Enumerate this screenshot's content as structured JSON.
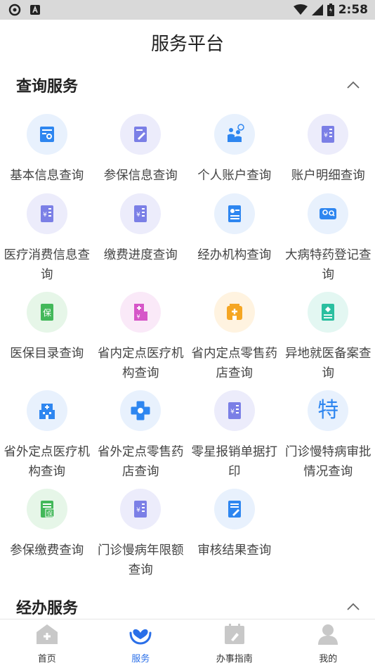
{
  "status": {
    "time": "2:58"
  },
  "header": {
    "title": "服务平台"
  },
  "query_section": {
    "title": "查询服务",
    "items": [
      {
        "label": "基本信息查询",
        "icon": "certificate-icon",
        "color": "#2e86f0",
        "bg": "#e8f1fd"
      },
      {
        "label": "参保信息查询",
        "icon": "edit-document-icon",
        "color": "#7b7fe6",
        "bg": "#ececfb"
      },
      {
        "label": "个人账户查询",
        "icon": "people-icon",
        "color": "#2e86f0",
        "bg": "#e8f1fd"
      },
      {
        "label": "账户明细查询",
        "icon": "ledger-icon",
        "color": "#7b7fe6",
        "bg": "#ececfb"
      },
      {
        "label": "医疗消费信息查询",
        "icon": "ledger-icon",
        "color": "#7b7fe6",
        "bg": "#ececfb"
      },
      {
        "label": "缴费进度查询",
        "icon": "ledger-icon",
        "color": "#7b7fe6",
        "bg": "#ececfb"
      },
      {
        "label": "经办机构查询",
        "icon": "id-card-icon",
        "color": "#2e86f0",
        "bg": "#e8f1fd"
      },
      {
        "label": "大病特药登记查询",
        "icon": "contact-search-icon",
        "color": "#2e86f0",
        "bg": "#e8f1fd"
      },
      {
        "label": "医保目录查询",
        "icon": "insurance-catalog-icon",
        "color": "#43b85a",
        "bg": "#e6f6e8"
      },
      {
        "label": "省内定点医疗机构查询",
        "icon": "hospital-chart-icon",
        "color": "#d656c8",
        "bg": "#fae9f8"
      },
      {
        "label": "省内定点零售药店查询",
        "icon": "pharmacy-icon",
        "color": "#f5a623",
        "bg": "#fff3e0"
      },
      {
        "label": "异地就医备案查询",
        "icon": "record-icon",
        "color": "#2bbfa0",
        "bg": "#e3f7f2"
      },
      {
        "label": "省外定点医疗机构查询",
        "icon": "hospital-building-icon",
        "color": "#2e86f0",
        "bg": "#e8f1fd"
      },
      {
        "label": "省外定点零售药店查询",
        "icon": "medical-cross-icon",
        "color": "#2e86f0",
        "bg": "#e8f1fd"
      },
      {
        "label": "零星报销单据打印",
        "icon": "ledger-icon",
        "color": "#7b7fe6",
        "bg": "#ececfb"
      },
      {
        "label": "门诊慢特病审批情况查询",
        "icon": "special-char-icon",
        "color": "#2e86f0",
        "bg": "#e8f1fd",
        "glyph": "特"
      },
      {
        "label": "参保缴费查询",
        "icon": "insurance-payment-icon",
        "color": "#43b85a",
        "bg": "#e6f6e8"
      },
      {
        "label": "门诊慢病年限额查询",
        "icon": "ledger-icon",
        "color": "#7b7fe6",
        "bg": "#ececfb"
      },
      {
        "label": "审核结果查询",
        "icon": "document-pen-icon",
        "color": "#2e86f0",
        "bg": "#e8f1fd"
      }
    ]
  },
  "handle_section": {
    "title": "经办服务"
  },
  "tabbar": {
    "tabs": [
      {
        "label": "首页",
        "icon": "home-icon"
      },
      {
        "label": "服务",
        "icon": "service-heart-icon",
        "active": true
      },
      {
        "label": "办事指南",
        "icon": "guide-calendar-icon"
      },
      {
        "label": "我的",
        "icon": "profile-icon"
      }
    ],
    "active_color": "#2a6fe8",
    "inactive_icon_color": "#c8c8c8"
  },
  "stamps": {
    "insurance_char": "保"
  }
}
